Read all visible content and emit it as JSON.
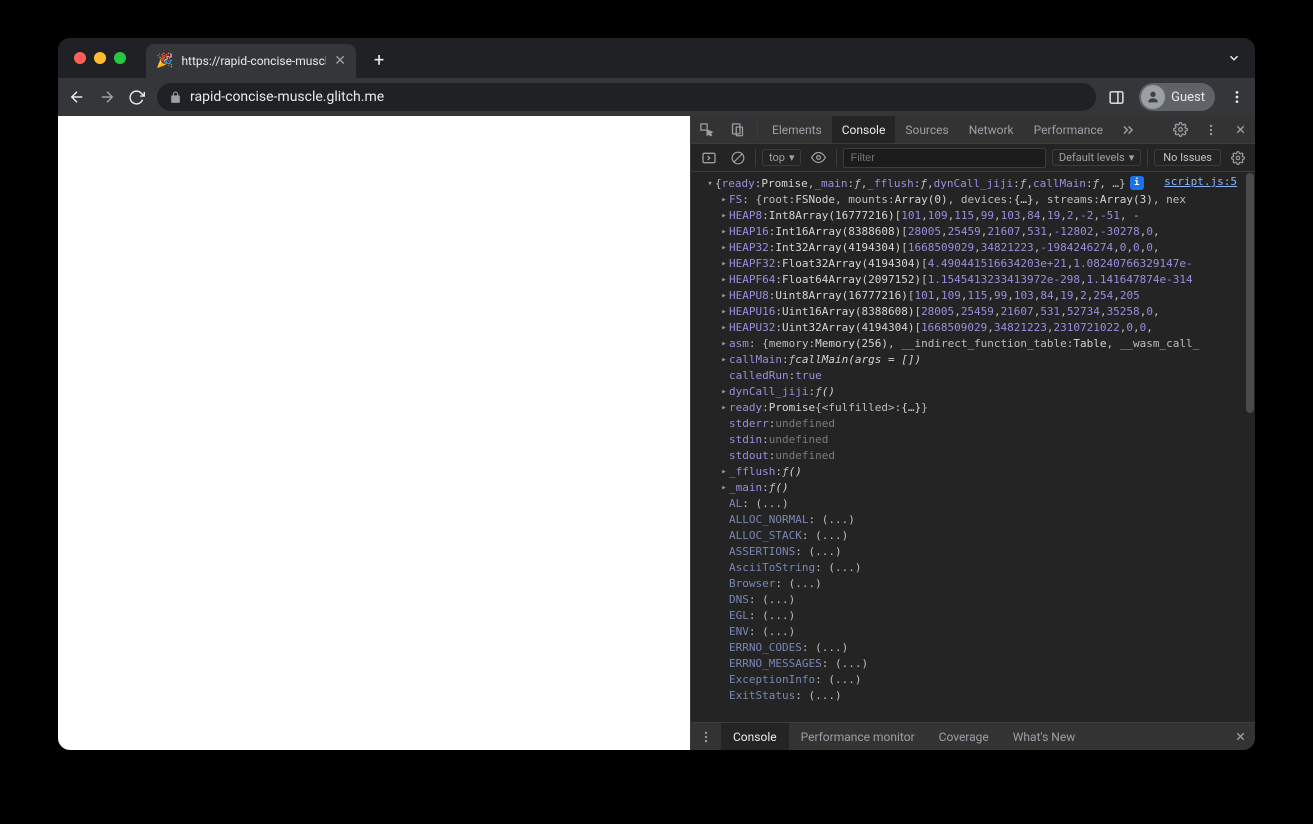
{
  "browser": {
    "tab_title": "https://rapid-concise-muscle.g",
    "url": "rapid-concise-muscle.glitch.me",
    "guest_label": "Guest"
  },
  "devtools": {
    "tabs": [
      "Elements",
      "Console",
      "Sources",
      "Network",
      "Performance"
    ],
    "active_tab": "Console",
    "context": "top",
    "filter_placeholder": "Filter",
    "levels": "Default levels",
    "issues": "No Issues",
    "source_link": "script.js:5"
  },
  "console": {
    "summary": [
      {
        "t": "key",
        "v": "ready"
      },
      {
        "t": "punc",
        "v": ": "
      },
      {
        "t": "type",
        "v": "Promise"
      },
      {
        "t": "punc",
        "v": ", "
      },
      {
        "t": "key",
        "v": "_main"
      },
      {
        "t": "punc",
        "v": ": "
      },
      {
        "t": "kw",
        "v": "ƒ"
      },
      {
        "t": "punc",
        "v": ", "
      },
      {
        "t": "key",
        "v": "_fflush"
      },
      {
        "t": "punc",
        "v": ": "
      },
      {
        "t": "kw",
        "v": "ƒ"
      },
      {
        "t": "punc",
        "v": ", "
      },
      {
        "t": "key",
        "v": "dynCall_jiji"
      },
      {
        "t": "punc",
        "v": ": "
      },
      {
        "t": "kw",
        "v": "ƒ"
      },
      {
        "t": "punc",
        "v": ", "
      },
      {
        "t": "key",
        "v": "callMain"
      },
      {
        "t": "punc",
        "v": ": "
      },
      {
        "t": "kw",
        "v": "ƒ"
      },
      {
        "t": "punc",
        "v": ", …}"
      }
    ],
    "rows": [
      {
        "arrow": "▸",
        "tokens": [
          {
            "t": "key",
            "v": "FS"
          },
          {
            "t": "punc",
            "v": ": {root: "
          },
          {
            "t": "type",
            "v": "FSNode"
          },
          {
            "t": "punc",
            "v": ", mounts: "
          },
          {
            "t": "type",
            "v": "Array(0)"
          },
          {
            "t": "punc",
            "v": ", devices: "
          },
          {
            "t": "type",
            "v": "{…}"
          },
          {
            "t": "punc",
            "v": ", streams: "
          },
          {
            "t": "type",
            "v": "Array(3)"
          },
          {
            "t": "punc",
            "v": ", nex"
          }
        ]
      },
      {
        "arrow": "▸",
        "tokens": [
          {
            "t": "key",
            "v": "HEAP8"
          },
          {
            "t": "punc",
            "v": ": "
          },
          {
            "t": "type",
            "v": "Int8Array(16777216)"
          },
          {
            "t": "punc",
            "v": " ["
          },
          {
            "t": "num",
            "v": "101"
          },
          {
            "t": "punc",
            "v": ", "
          },
          {
            "t": "num",
            "v": "109"
          },
          {
            "t": "punc",
            "v": ", "
          },
          {
            "t": "num",
            "v": "115"
          },
          {
            "t": "punc",
            "v": ", "
          },
          {
            "t": "num",
            "v": "99"
          },
          {
            "t": "punc",
            "v": ", "
          },
          {
            "t": "num",
            "v": "103"
          },
          {
            "t": "punc",
            "v": ", "
          },
          {
            "t": "num",
            "v": "84"
          },
          {
            "t": "punc",
            "v": ", "
          },
          {
            "t": "num",
            "v": "19"
          },
          {
            "t": "punc",
            "v": ", "
          },
          {
            "t": "num",
            "v": "2"
          },
          {
            "t": "punc",
            "v": ", "
          },
          {
            "t": "num",
            "v": "-2"
          },
          {
            "t": "punc",
            "v": ", "
          },
          {
            "t": "num",
            "v": "-51"
          },
          {
            "t": "punc",
            "v": ", -"
          }
        ]
      },
      {
        "arrow": "▸",
        "tokens": [
          {
            "t": "key",
            "v": "HEAP16"
          },
          {
            "t": "punc",
            "v": ": "
          },
          {
            "t": "type",
            "v": "Int16Array(8388608)"
          },
          {
            "t": "punc",
            "v": " ["
          },
          {
            "t": "num",
            "v": "28005"
          },
          {
            "t": "punc",
            "v": ", "
          },
          {
            "t": "num",
            "v": "25459"
          },
          {
            "t": "punc",
            "v": ", "
          },
          {
            "t": "num",
            "v": "21607"
          },
          {
            "t": "punc",
            "v": ", "
          },
          {
            "t": "num",
            "v": "531"
          },
          {
            "t": "punc",
            "v": ", "
          },
          {
            "t": "num",
            "v": "-12802"
          },
          {
            "t": "punc",
            "v": ", "
          },
          {
            "t": "num",
            "v": "-30278"
          },
          {
            "t": "punc",
            "v": ", "
          },
          {
            "t": "num",
            "v": "0"
          },
          {
            "t": "punc",
            "v": ","
          }
        ]
      },
      {
        "arrow": "▸",
        "tokens": [
          {
            "t": "key",
            "v": "HEAP32"
          },
          {
            "t": "punc",
            "v": ": "
          },
          {
            "t": "type",
            "v": "Int32Array(4194304)"
          },
          {
            "t": "punc",
            "v": " ["
          },
          {
            "t": "num",
            "v": "1668509029"
          },
          {
            "t": "punc",
            "v": ", "
          },
          {
            "t": "num",
            "v": "34821223"
          },
          {
            "t": "punc",
            "v": ", "
          },
          {
            "t": "num",
            "v": "-1984246274"
          },
          {
            "t": "punc",
            "v": ", "
          },
          {
            "t": "num",
            "v": "0"
          },
          {
            "t": "punc",
            "v": ", "
          },
          {
            "t": "num",
            "v": "0"
          },
          {
            "t": "punc",
            "v": ", "
          },
          {
            "t": "num",
            "v": "0"
          },
          {
            "t": "punc",
            "v": ", "
          }
        ]
      },
      {
        "arrow": "▸",
        "tokens": [
          {
            "t": "key",
            "v": "HEAPF32"
          },
          {
            "t": "punc",
            "v": ": "
          },
          {
            "t": "type",
            "v": "Float32Array(4194304)"
          },
          {
            "t": "punc",
            "v": " ["
          },
          {
            "t": "num",
            "v": "4.490441516634203e+21"
          },
          {
            "t": "punc",
            "v": ", "
          },
          {
            "t": "num",
            "v": "1.08240766329147e-"
          }
        ]
      },
      {
        "arrow": "▸",
        "tokens": [
          {
            "t": "key",
            "v": "HEAPF64"
          },
          {
            "t": "punc",
            "v": ": "
          },
          {
            "t": "type",
            "v": "Float64Array(2097152)"
          },
          {
            "t": "punc",
            "v": " ["
          },
          {
            "t": "num",
            "v": "1.1545413233413972e-298"
          },
          {
            "t": "punc",
            "v": ", "
          },
          {
            "t": "num",
            "v": "1.141647874e-314"
          }
        ]
      },
      {
        "arrow": "▸",
        "tokens": [
          {
            "t": "key",
            "v": "HEAPU8"
          },
          {
            "t": "punc",
            "v": ": "
          },
          {
            "t": "type",
            "v": "Uint8Array(16777216)"
          },
          {
            "t": "punc",
            "v": " ["
          },
          {
            "t": "num",
            "v": "101"
          },
          {
            "t": "punc",
            "v": ", "
          },
          {
            "t": "num",
            "v": "109"
          },
          {
            "t": "punc",
            "v": ", "
          },
          {
            "t": "num",
            "v": "115"
          },
          {
            "t": "punc",
            "v": ", "
          },
          {
            "t": "num",
            "v": "99"
          },
          {
            "t": "punc",
            "v": ", "
          },
          {
            "t": "num",
            "v": "103"
          },
          {
            "t": "punc",
            "v": ", "
          },
          {
            "t": "num",
            "v": "84"
          },
          {
            "t": "punc",
            "v": ", "
          },
          {
            "t": "num",
            "v": "19"
          },
          {
            "t": "punc",
            "v": ", "
          },
          {
            "t": "num",
            "v": "2"
          },
          {
            "t": "punc",
            "v": ", "
          },
          {
            "t": "num",
            "v": "254"
          },
          {
            "t": "punc",
            "v": ", "
          },
          {
            "t": "num",
            "v": "205"
          }
        ]
      },
      {
        "arrow": "▸",
        "tokens": [
          {
            "t": "key",
            "v": "HEAPU16"
          },
          {
            "t": "punc",
            "v": ": "
          },
          {
            "t": "type",
            "v": "Uint16Array(8388608)"
          },
          {
            "t": "punc",
            "v": " ["
          },
          {
            "t": "num",
            "v": "28005"
          },
          {
            "t": "punc",
            "v": ", "
          },
          {
            "t": "num",
            "v": "25459"
          },
          {
            "t": "punc",
            "v": ", "
          },
          {
            "t": "num",
            "v": "21607"
          },
          {
            "t": "punc",
            "v": ", "
          },
          {
            "t": "num",
            "v": "531"
          },
          {
            "t": "punc",
            "v": ", "
          },
          {
            "t": "num",
            "v": "52734"
          },
          {
            "t": "punc",
            "v": ", "
          },
          {
            "t": "num",
            "v": "35258"
          },
          {
            "t": "punc",
            "v": ", "
          },
          {
            "t": "num",
            "v": "0"
          },
          {
            "t": "punc",
            "v": ","
          }
        ]
      },
      {
        "arrow": "▸",
        "tokens": [
          {
            "t": "key",
            "v": "HEAPU32"
          },
          {
            "t": "punc",
            "v": ": "
          },
          {
            "t": "type",
            "v": "Uint32Array(4194304)"
          },
          {
            "t": "punc",
            "v": " ["
          },
          {
            "t": "num",
            "v": "1668509029"
          },
          {
            "t": "punc",
            "v": ", "
          },
          {
            "t": "num",
            "v": "34821223"
          },
          {
            "t": "punc",
            "v": ", "
          },
          {
            "t": "num",
            "v": "2310721022"
          },
          {
            "t": "punc",
            "v": ", "
          },
          {
            "t": "num",
            "v": "0"
          },
          {
            "t": "punc",
            "v": ", "
          },
          {
            "t": "num",
            "v": "0"
          },
          {
            "t": "punc",
            "v": ","
          }
        ]
      },
      {
        "arrow": "▸",
        "tokens": [
          {
            "t": "key",
            "v": "asm"
          },
          {
            "t": "punc",
            "v": ": {memory: "
          },
          {
            "t": "type",
            "v": "Memory(256)"
          },
          {
            "t": "punc",
            "v": ", __indirect_function_table: "
          },
          {
            "t": "type",
            "v": "Table"
          },
          {
            "t": "punc",
            "v": ", __wasm_call_"
          }
        ]
      },
      {
        "arrow": "▸",
        "tokens": [
          {
            "t": "key",
            "v": "callMain"
          },
          {
            "t": "punc",
            "v": ": "
          },
          {
            "t": "kw",
            "v": "ƒ "
          },
          {
            "t": "fsig",
            "v": "callMain(args = [])"
          }
        ]
      },
      {
        "arrow": "",
        "tokens": [
          {
            "t": "key",
            "v": "calledRun"
          },
          {
            "t": "punc",
            "v": ": "
          },
          {
            "t": "bool",
            "v": "true"
          }
        ]
      },
      {
        "arrow": "▸",
        "tokens": [
          {
            "t": "key",
            "v": "dynCall_jiji"
          },
          {
            "t": "punc",
            "v": ": "
          },
          {
            "t": "kw",
            "v": "ƒ "
          },
          {
            "t": "fsig",
            "v": "()"
          }
        ]
      },
      {
        "arrow": "▸",
        "tokens": [
          {
            "t": "key",
            "v": "ready"
          },
          {
            "t": "punc",
            "v": ": "
          },
          {
            "t": "type",
            "v": "Promise "
          },
          {
            "t": "punc",
            "v": "{<fulfilled>: "
          },
          {
            "t": "type",
            "v": "{…}"
          },
          {
            "t": "punc",
            "v": "}"
          }
        ]
      },
      {
        "arrow": "",
        "tokens": [
          {
            "t": "key",
            "v": "stderr"
          },
          {
            "t": "punc",
            "v": ": "
          },
          {
            "t": "undef",
            "v": "undefined"
          }
        ]
      },
      {
        "arrow": "",
        "tokens": [
          {
            "t": "key",
            "v": "stdin"
          },
          {
            "t": "punc",
            "v": ": "
          },
          {
            "t": "undef",
            "v": "undefined"
          }
        ]
      },
      {
        "arrow": "",
        "tokens": [
          {
            "t": "key",
            "v": "stdout"
          },
          {
            "t": "punc",
            "v": ": "
          },
          {
            "t": "undef",
            "v": "undefined"
          }
        ]
      },
      {
        "arrow": "▸",
        "tokens": [
          {
            "t": "key",
            "v": "_fflush"
          },
          {
            "t": "punc",
            "v": ": "
          },
          {
            "t": "kw",
            "v": "ƒ "
          },
          {
            "t": "fsig",
            "v": "()"
          }
        ]
      },
      {
        "arrow": "▸",
        "tokens": [
          {
            "t": "key",
            "v": "_main"
          },
          {
            "t": "punc",
            "v": ": "
          },
          {
            "t": "kw",
            "v": "ƒ "
          },
          {
            "t": "fsig",
            "v": "()"
          }
        ]
      },
      {
        "arrow": "",
        "tokens": [
          {
            "t": "keydim",
            "v": "AL"
          },
          {
            "t": "punc",
            "v": ": (...)"
          }
        ]
      },
      {
        "arrow": "",
        "tokens": [
          {
            "t": "keydim",
            "v": "ALLOC_NORMAL"
          },
          {
            "t": "punc",
            "v": ": (...)"
          }
        ]
      },
      {
        "arrow": "",
        "tokens": [
          {
            "t": "keydim",
            "v": "ALLOC_STACK"
          },
          {
            "t": "punc",
            "v": ": (...)"
          }
        ]
      },
      {
        "arrow": "",
        "tokens": [
          {
            "t": "keydim",
            "v": "ASSERTIONS"
          },
          {
            "t": "punc",
            "v": ": (...)"
          }
        ]
      },
      {
        "arrow": "",
        "tokens": [
          {
            "t": "keydim",
            "v": "AsciiToString"
          },
          {
            "t": "punc",
            "v": ": (...)"
          }
        ]
      },
      {
        "arrow": "",
        "tokens": [
          {
            "t": "keydim",
            "v": "Browser"
          },
          {
            "t": "punc",
            "v": ": (...)"
          }
        ]
      },
      {
        "arrow": "",
        "tokens": [
          {
            "t": "keydim",
            "v": "DNS"
          },
          {
            "t": "punc",
            "v": ": (...)"
          }
        ]
      },
      {
        "arrow": "",
        "tokens": [
          {
            "t": "keydim",
            "v": "EGL"
          },
          {
            "t": "punc",
            "v": ": (...)"
          }
        ]
      },
      {
        "arrow": "",
        "tokens": [
          {
            "t": "keydim",
            "v": "ENV"
          },
          {
            "t": "punc",
            "v": ": (...)"
          }
        ]
      },
      {
        "arrow": "",
        "tokens": [
          {
            "t": "keydim",
            "v": "ERRNO_CODES"
          },
          {
            "t": "punc",
            "v": ": (...)"
          }
        ]
      },
      {
        "arrow": "",
        "tokens": [
          {
            "t": "keydim",
            "v": "ERRNO_MESSAGES"
          },
          {
            "t": "punc",
            "v": ": (...)"
          }
        ]
      },
      {
        "arrow": "",
        "tokens": [
          {
            "t": "keydim",
            "v": "ExceptionInfo"
          },
          {
            "t": "punc",
            "v": ": (...)"
          }
        ]
      },
      {
        "arrow": "",
        "tokens": [
          {
            "t": "keydim",
            "v": "ExitStatus"
          },
          {
            "t": "punc",
            "v": ": (...)"
          }
        ]
      }
    ]
  },
  "drawer": {
    "tabs": [
      "Console",
      "Performance monitor",
      "Coverage",
      "What's New"
    ],
    "active_tab": "Console"
  }
}
